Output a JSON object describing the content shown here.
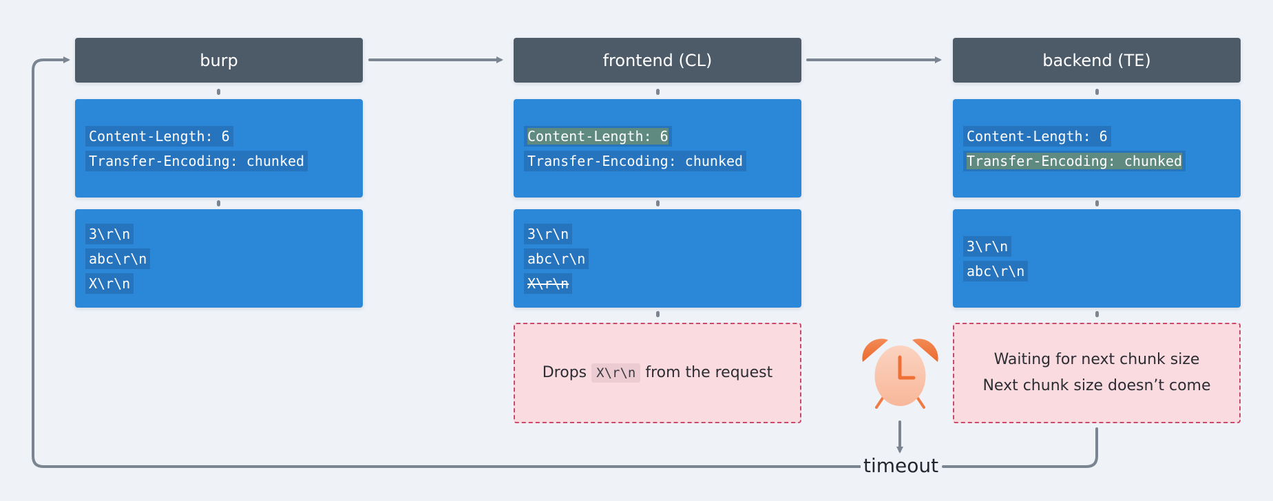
{
  "nodes": [
    {
      "title": "burp",
      "headers": [
        {
          "text": "Content-Length: 6",
          "highlighted": false
        },
        {
          "text": "Transfer-Encoding: chunked",
          "highlighted": false
        }
      ],
      "body": [
        {
          "text": "3\\r\\n",
          "struck": false
        },
        {
          "text": "abc\\r\\n",
          "struck": false
        },
        {
          "text": "X\\r\\n",
          "struck": false
        }
      ]
    },
    {
      "title": "frontend (CL)",
      "headers": [
        {
          "text": "Content-Length: 6",
          "highlighted": true
        },
        {
          "text": "Transfer-Encoding: chunked",
          "highlighted": false
        }
      ],
      "body": [
        {
          "text": "3\\r\\n",
          "struck": false
        },
        {
          "text": "abc\\r\\n",
          "struck": false
        },
        {
          "text": "X\\r\\n",
          "struck": true
        }
      ],
      "note": {
        "prefix": "Drops",
        "code": "X\\r\\n",
        "suffix": "from the request"
      }
    },
    {
      "title": "backend (TE)",
      "headers": [
        {
          "text": "Content-Length: 6",
          "highlighted": false
        },
        {
          "text": "Transfer-Encoding: chunked",
          "highlighted": true
        }
      ],
      "body": [
        {
          "text": "3\\r\\n",
          "struck": false
        },
        {
          "text": "abc\\r\\n",
          "struck": false
        }
      ],
      "note": {
        "lines": [
          "Waiting for next chunk size",
          "Next chunk size doesn’t come"
        ]
      }
    }
  ],
  "timeout": {
    "label": "timeout",
    "icon": "alarm-clock-icon"
  },
  "colors": {
    "header_bg": "#4d5a68",
    "block_bg": "#2b87d8",
    "highlight": "#5f8a7f",
    "note_bg": "#f9dbe0",
    "note_border": "#c9496a",
    "connector": "#7b8591",
    "clock": "#f07a3e"
  }
}
